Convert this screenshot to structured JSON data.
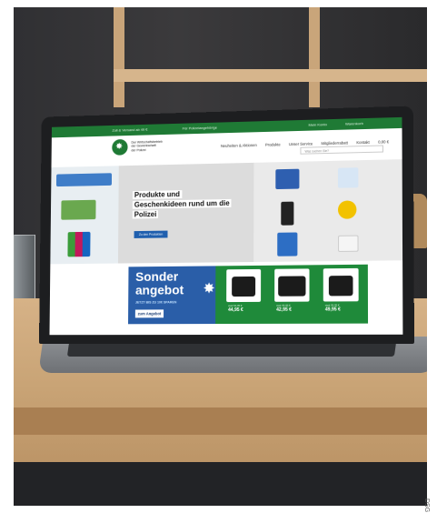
{
  "scene": {
    "description_subject": "laptop on wooden table displaying police shop website"
  },
  "website": {
    "topbar": {
      "left_text": "Zoll & Versand ab 49 €",
      "mid_text": "Für Polizeiangehörige",
      "right_links": [
        "Mein Konto",
        "Warenkorb"
      ]
    },
    "brand": {
      "name_lines": [
        "Der Wirtschaftsbetrieb",
        "der Gewerkschaft",
        "der Polizei"
      ],
      "logo_icon": "police-star-icon"
    },
    "nav": {
      "items": [
        "Neuheiten & Aktionen",
        "Produkte",
        "Unser Service",
        "Mitgliederrabatt",
        "Kontakt",
        "0,00 €"
      ]
    },
    "search": {
      "placeholder": "Was suchen Sie?"
    },
    "hero": {
      "title_lines": [
        "Produkte und",
        "Geschenkideen rund um die",
        "Polizei"
      ],
      "button_label": "Zu den Produkten"
    },
    "promo": {
      "headline_line1": "Sonder",
      "headline_line2": "angebot",
      "subline": "JETZT BIS ZU 10€ SPAREN",
      "cta_label": "zum Angebot",
      "products": [
        {
          "price": "44,95 €",
          "note": "statt 54,95 €"
        },
        {
          "price": "42,95 €",
          "note": "statt 49,95 €"
        },
        {
          "price": "49,95 €",
          "note": "statt 59,95 €"
        }
      ]
    }
  },
  "credit": "DSG",
  "colors": {
    "brand_green": "#1f7a35",
    "promo_blue": "#2a5ea8",
    "promo_green": "#1f8a3a",
    "cta_blue": "#1f5fae"
  }
}
